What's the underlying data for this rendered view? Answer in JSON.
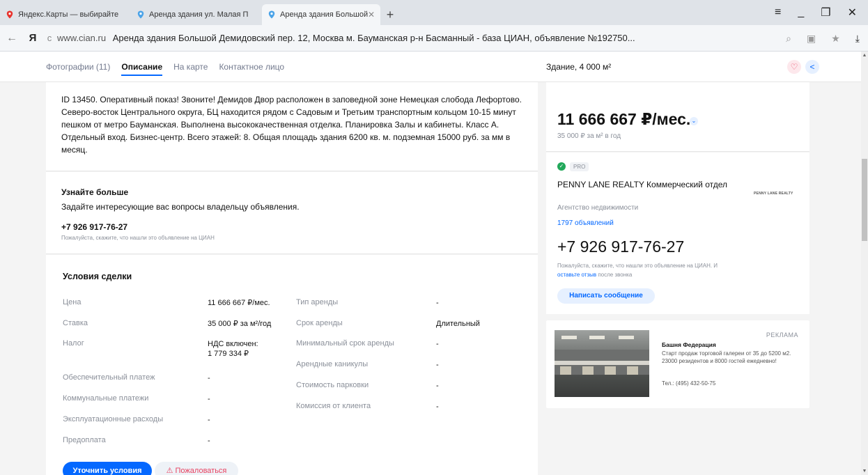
{
  "browser": {
    "tabs": [
      {
        "title": "Яндекс.Карты — выбирайте",
        "active": false
      },
      {
        "title": "Аренда здания ул. Малая П",
        "active": false
      },
      {
        "title": "Аренда здания Большой",
        "active": true
      }
    ],
    "new_tab": "+",
    "win_controls": {
      "menu": "≡",
      "minimize": "_",
      "restore": "❐",
      "close": "✕"
    },
    "address": {
      "back": "←",
      "logo": "Я",
      "reload": "c",
      "domain": "www.cian.ru",
      "title": "Аренда здания Большой Демидовский пер. 12, Москва м. Бауманская р-н Басманный - база ЦИАН, объявление №192750..."
    }
  },
  "page_header": {
    "tabs": [
      "Фотографии (11)",
      "Описание",
      "На карте",
      "Контактное лицо"
    ],
    "active_tab": "Описание",
    "summary": "Здание, 4 000 м²",
    "favorite_icon": "♡",
    "share_icon": "<"
  },
  "description": "ID 13450. Оперативный показ! Звоните! Демидов Двор расположен в заповедной зоне Немецкая слобода Лефортово. Северо-восток Центрального округа, БЦ находится рядом с Садовым и Третьим транспортным кольцом 10-15 минут пешком от метро Бауманская. Выполнена высококачественная отделка. Планировка Залы и кабинеты. Класс А. Отдельный вход. Бизнес-центр. Всего этажей: 8. Общая площадь здания 6200 кв. м. подземная 15000 руб. за мм в месяц.",
  "learn_more": {
    "title": "Узнайте больше",
    "subtitle": "Задайте интересующие вас вопросы владельцу объявления.",
    "phone": "+7 926 917-76-27",
    "note": "Пожалуйста, скажите, что нашли это объявление на ЦИАН"
  },
  "deal_terms": {
    "title": "Условия сделки",
    "left": [
      {
        "label": "Цена",
        "value": "11 666 667 ₽/мес."
      },
      {
        "label": "Ставка",
        "value": "35 000 ₽ за м²/год"
      },
      {
        "label": "Налог",
        "value": "НДС включен: 1 779 334 ₽"
      },
      {
        "label": "Обеспечительный платеж",
        "value": "-"
      },
      {
        "label": "Коммунальные платежи",
        "value": "-"
      },
      {
        "label": "Эксплуатационные расходы",
        "value": "-"
      },
      {
        "label": "Предоплата",
        "value": "-"
      }
    ],
    "right": [
      {
        "label": "Тип аренды",
        "value": "-"
      },
      {
        "label": "Срок аренды",
        "value": "Длительный"
      },
      {
        "label": "Минимальный срок аренды",
        "value": "-"
      },
      {
        "label": "Арендные каникулы",
        "value": "-"
      },
      {
        "label": "Стоимость парковки",
        "value": "-"
      },
      {
        "label": "Комиссия от клиента",
        "value": "-"
      }
    ],
    "btn_clarify": "Уточнить условия",
    "btn_complain": "⚠ Пожаловаться"
  },
  "price_card": {
    "price": "11 666 667 ₽/мес.",
    "per_meter": "35 000 ₽ за м² в год"
  },
  "agent": {
    "badge": "PRO",
    "name": "PENNY LANE REALTY Коммерческий отдел",
    "logo_text": "PENNY LANE REALTY",
    "type": "Агентство недвижимости",
    "ads_count": "1797 объявлений",
    "phone": "+7 926 917-76-27",
    "note_prefix": "Пожалуйста, скажите, что нашли это объявление на ЦИАН. И ",
    "note_link": "оставьте отзыв",
    "note_suffix": " после звонка",
    "message_btn": "Написать сообщение"
  },
  "ad": {
    "label": "РЕКЛАМА",
    "title": "Башня Федерация",
    "text": "Старт продаж торговой галереи от 35 до 5200 м2. 23000 резидентов и 8000 гостей ежедневно!",
    "phone": "Тел.: (495) 432-50-75"
  },
  "colors": {
    "accent": "#0468ff",
    "danger": "#e84260",
    "pro_green": "#22a85a",
    "muted": "#8a8f99"
  }
}
